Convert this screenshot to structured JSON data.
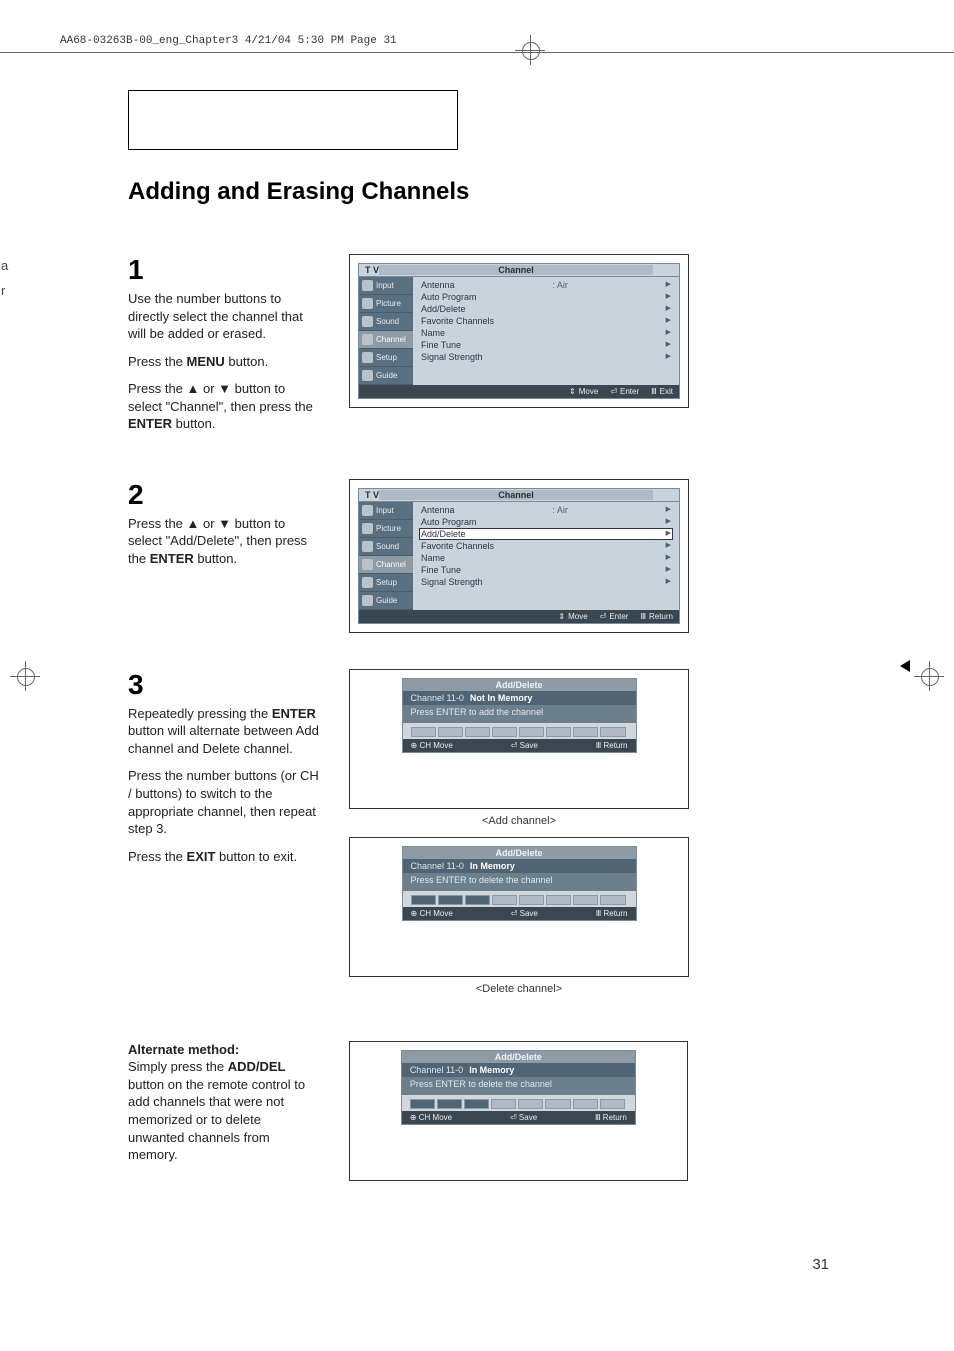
{
  "header": "AA68-03263B-00_eng_Chapter3  4/21/04  5:30 PM  Page 31",
  "title": "Adding and Erasing Channels",
  "left_letters": [
    "a",
    "r"
  ],
  "steps": {
    "s1": {
      "num": "1",
      "p1": "Use the number buttons to directly select the channel that will be added or erased.",
      "p2a": "Press the ",
      "p2b": "MENU",
      "p2c": " button.",
      "p3a": "Press the ▲ or ▼ button to select \"Channel\", then press the ",
      "p3b": "ENTER",
      "p3c": " button."
    },
    "s2": {
      "num": "2",
      "p1a": "Press the ▲ or ▼ button to select \"Add/Delete\", then press the ",
      "p1b": "ENTER",
      "p1c": " button."
    },
    "s3": {
      "num": "3",
      "p1a": "Repeatedly pressing the ",
      "p1b": "ENTER",
      "p1c": " button will alternate between Add channel and Delete   channel.",
      "p2": "Press the number buttons (or CH      /      buttons) to switch to the appropriate channel, then repeat step 3.",
      "p3a": "Press the ",
      "p3b": "EXIT",
      "p3c": " button to exit."
    }
  },
  "menu": {
    "tv": "T V",
    "heading": "Channel",
    "tabs": [
      "Input",
      "Picture",
      "Sound",
      "Channel",
      "Setup",
      "Guide"
    ],
    "items": {
      "antenna": "Antenna",
      "antenna_val": ":  Air",
      "auto": "Auto Program",
      "add": "Add/Delete",
      "fav": "Favorite Channels",
      "name": "Name",
      "fine": "Fine Tune",
      "signal": "Signal Strength"
    },
    "footer1": {
      "move": "Move",
      "enter": "Enter",
      "exit": "Exit"
    },
    "footer2": {
      "move": "Move",
      "enter": "Enter",
      "return": "Return"
    }
  },
  "sub_add": {
    "title": "Add/Delete",
    "row_ch": "Channel 11-0",
    "row_status": "Not In Memory",
    "row_msg": "Press ENTER to add the channel",
    "footer": {
      "chmove": "CH Move",
      "save": "Save",
      "return": "Return"
    },
    "caption": "<Add channel>"
  },
  "sub_del": {
    "title": "Add/Delete",
    "row_ch": "Channel 11-0",
    "row_status": "In Memory",
    "row_msg": "Press ENTER to delete the channel",
    "footer": {
      "chmove": "CH Move",
      "save": "Save",
      "return": "Return"
    },
    "caption": "<Delete channel>"
  },
  "alt": {
    "heading": "Alternate method:",
    "p1a": "Simply press the ",
    "p1b": "ADD/DEL",
    "p1c": " button on the remote control to add channels that were not memorized or to delete unwanted channels from memory."
  },
  "sub_alt": {
    "title": "Add/Delete",
    "row_ch": "Channel 11-0",
    "row_status": "In Memory",
    "row_msg": "Press ENTER to delete the channel",
    "footer": {
      "chmove": "CH Move",
      "save": "Save",
      "return": "Return"
    }
  },
  "page_num": "31"
}
